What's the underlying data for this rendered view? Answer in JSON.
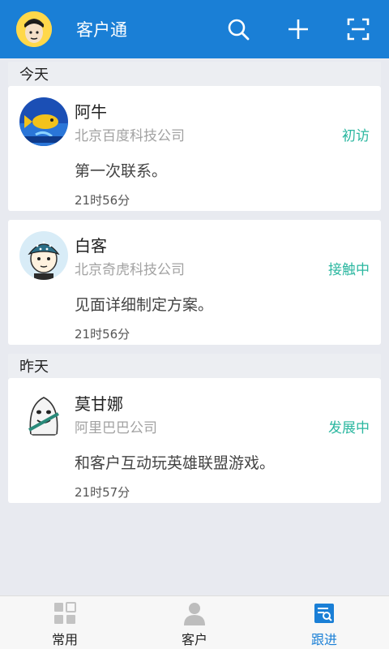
{
  "app": {
    "title": "客户通",
    "colors": {
      "primary": "#1a7fd6",
      "status": "#2bb7a0"
    },
    "icons": [
      "search-icon",
      "plus-icon",
      "scan-icon"
    ]
  },
  "sections": [
    {
      "header": "今天",
      "items": [
        {
          "name": "阿牛",
          "company": "北京百度科技公司",
          "status": "初访",
          "note": "第一次联系。",
          "time": "21时56分"
        },
        {
          "name": "白客",
          "company": "北京奇虎科技公司",
          "status": "接触中",
          "note": "见面详细制定方案。",
          "time": "21时56分"
        }
      ]
    },
    {
      "header": "昨天",
      "items": [
        {
          "name": "莫甘娜",
          "company": "阿里巴巴公司",
          "status": "发展中",
          "note": "和客户互动玩英雄联盟游戏。",
          "time": "21时57分"
        }
      ]
    }
  ],
  "bottom_nav": [
    {
      "label": "常用",
      "icon": "grid-icon",
      "active": false
    },
    {
      "label": "客户",
      "icon": "person-icon",
      "active": false
    },
    {
      "label": "跟进",
      "icon": "followup-icon",
      "active": true
    }
  ]
}
